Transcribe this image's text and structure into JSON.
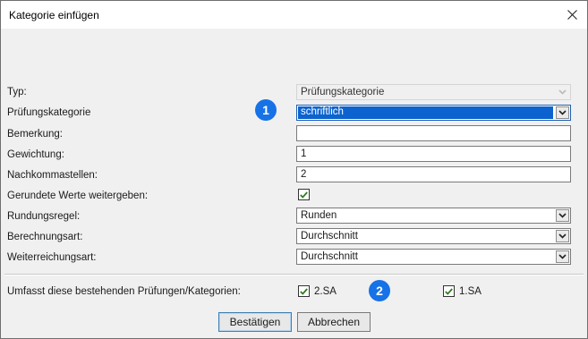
{
  "window": {
    "title": "Kategorie einfügen"
  },
  "form": {
    "typ": {
      "label": "Typ:",
      "value": "Prüfungskategorie"
    },
    "pruefungskategorie": {
      "label": "Prüfungskategorie",
      "value": "schriftlich"
    },
    "bemerkung": {
      "label": "Bemerkung:",
      "value": ""
    },
    "gewichtung": {
      "label": "Gewichtung:",
      "value": "1"
    },
    "nachkommastellen": {
      "label": "Nachkommastellen:",
      "value": "2"
    },
    "gerundete": {
      "label": "Gerundete Werte weitergeben:",
      "checked": true
    },
    "rundungsregel": {
      "label": "Rundungsregel:",
      "value": "Runden"
    },
    "berechnungsart": {
      "label": "Berechnungsart:",
      "value": "Durchschnitt"
    },
    "weiterreichungsart": {
      "label": "Weiterreichungsart:",
      "value": "Durchschnitt"
    }
  },
  "umfasst": {
    "label": "Umfasst diese bestehenden Prüfungen/Kategorien:",
    "items": [
      {
        "label": "2.SA",
        "checked": true
      },
      {
        "label": "1.SA",
        "checked": true
      }
    ]
  },
  "badges": [
    "1",
    "2"
  ],
  "buttons": {
    "confirm": "Bestätigen",
    "cancel": "Abbrechen"
  },
  "colors": {
    "accent": "#1672e6",
    "selection": "#0c63cf"
  }
}
